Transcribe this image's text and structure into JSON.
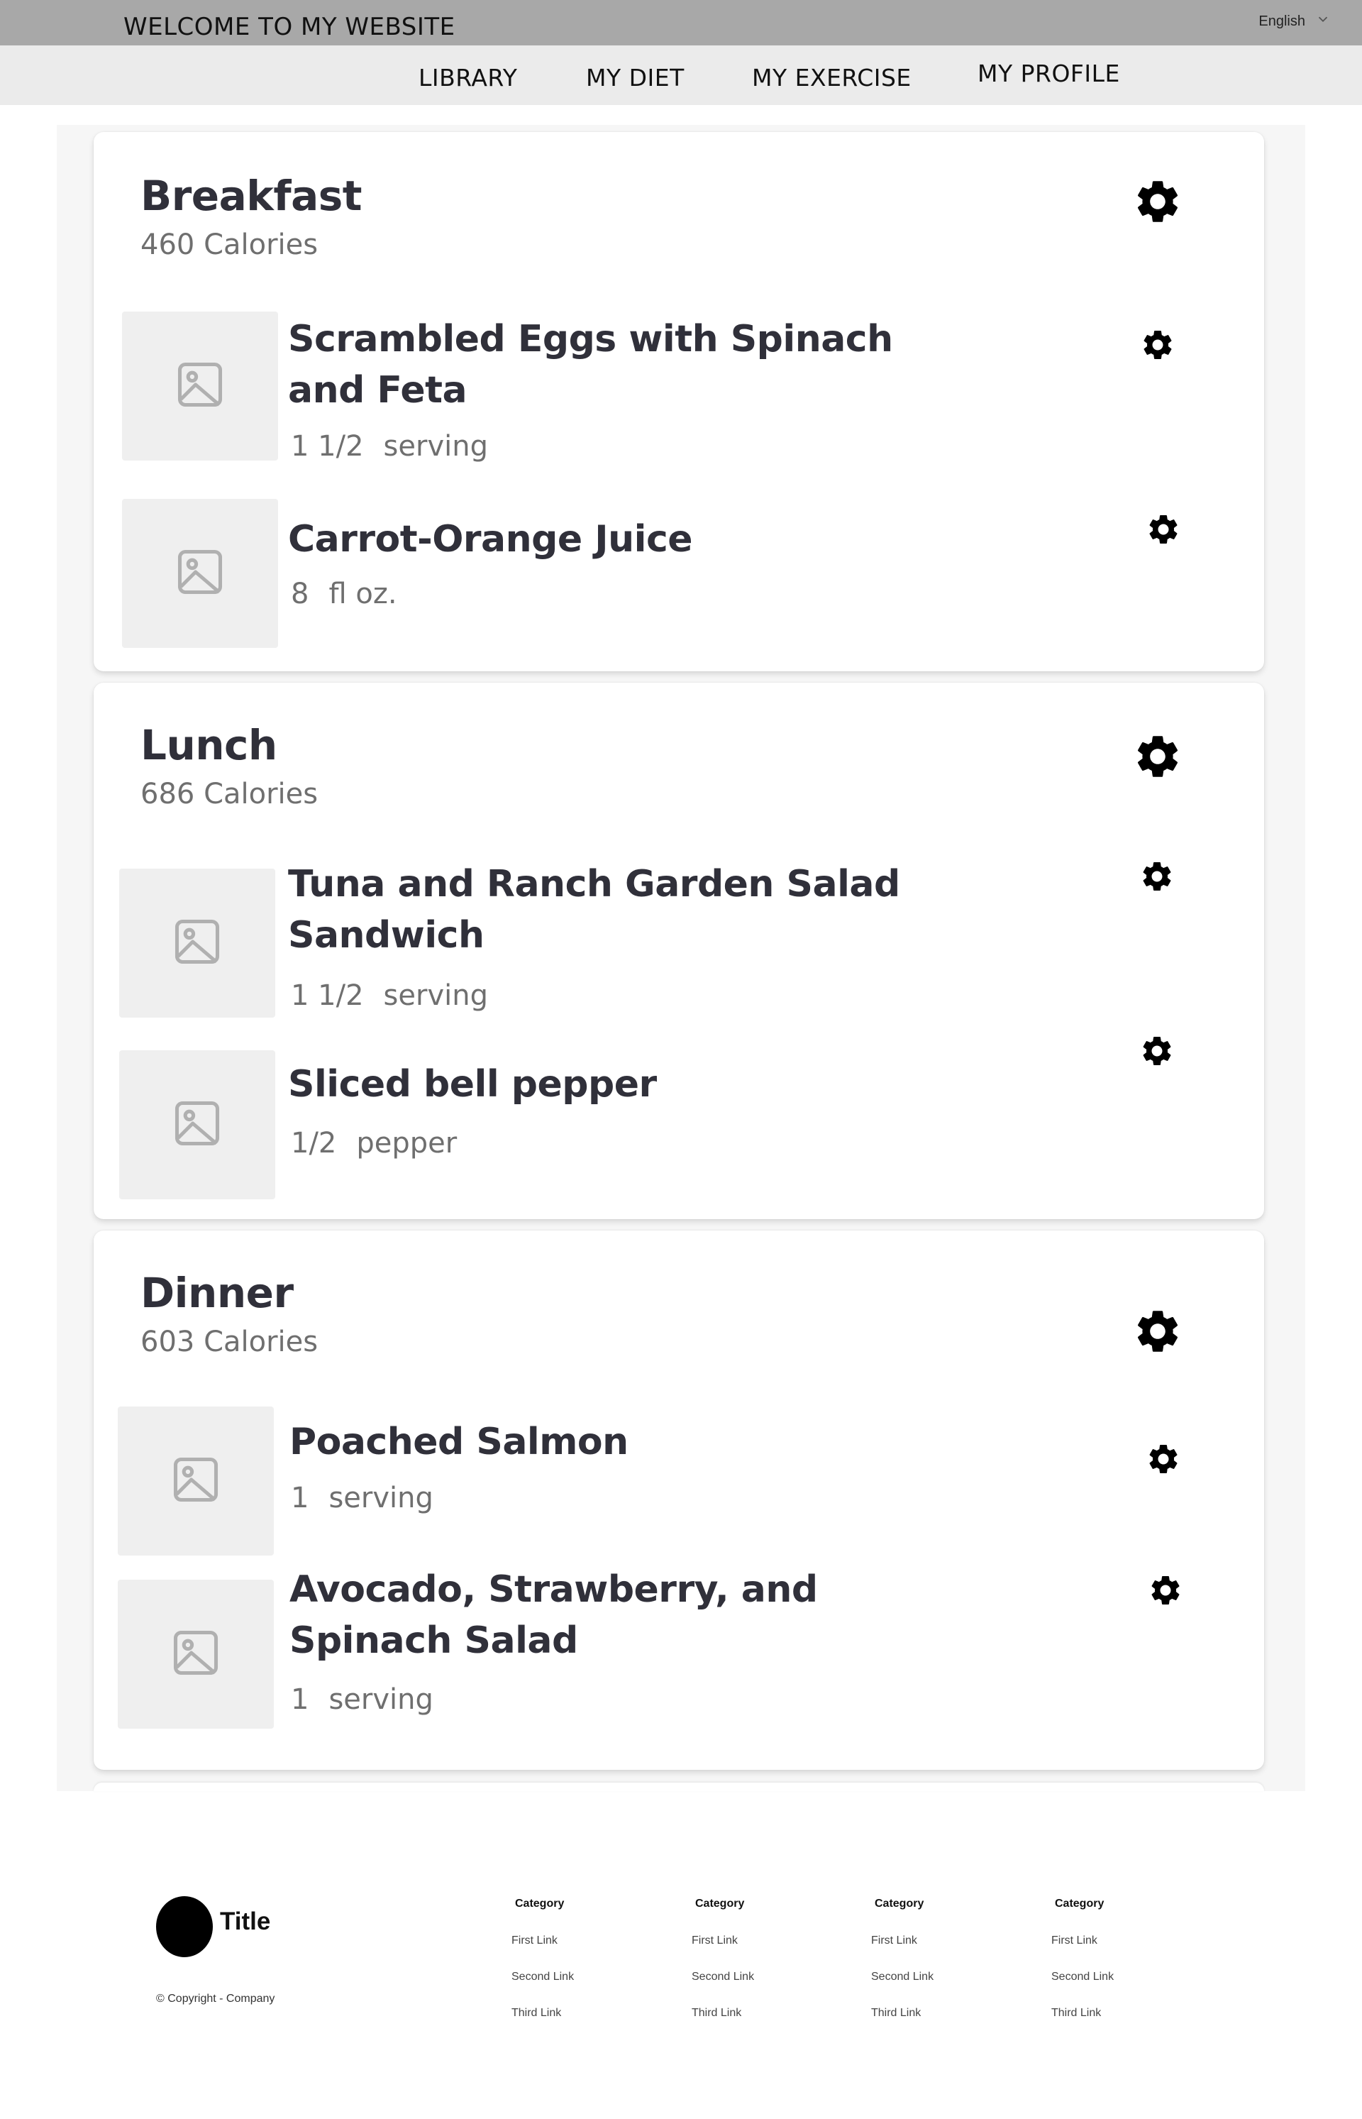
{
  "header": {
    "site_title": "WELCOME TO MY WEBSITE",
    "language": "English",
    "language_icon": "chevron-down-icon"
  },
  "nav": {
    "items": [
      "LIBRARY",
      "MY DIET",
      "MY EXERCISE",
      "MY PROFILE"
    ]
  },
  "meals": [
    {
      "name": "Breakfast",
      "calories": "460 Calories",
      "foods": [
        {
          "name": "Scrambled Eggs with Spinach and Feta",
          "amount": "1 1/2",
          "unit": "serving"
        },
        {
          "name": "Carrot-Orange Juice",
          "amount": "8",
          "unit": "fl oz."
        }
      ]
    },
    {
      "name": "Lunch",
      "calories": "686 Calories",
      "foods": [
        {
          "name": "Tuna and Ranch Garden Salad Sandwich",
          "amount": "1 1/2",
          "unit": "serving"
        },
        {
          "name": "Sliced bell pepper",
          "amount": "1/2",
          "unit": "pepper"
        }
      ]
    },
    {
      "name": "Dinner",
      "calories": "603 Calories",
      "foods": [
        {
          "name": "Poached Salmon",
          "amount": "1",
          "unit": "serving"
        },
        {
          "name": "Avocado, Strawberry, and Spinach Salad",
          "amount": "1",
          "unit": "serving"
        }
      ]
    }
  ],
  "icons": {
    "settings": "gear-icon",
    "food_image": "image-placeholder-icon"
  },
  "footer": {
    "title": "Title",
    "copyright": "© Copyright - Company",
    "columns": [
      {
        "category": "Category",
        "links": [
          "First Link",
          "Second Link",
          "Third Link"
        ]
      },
      {
        "category": "Category",
        "links": [
          "First Link",
          "Second Link",
          "Third Link"
        ]
      },
      {
        "category": "Category",
        "links": [
          "First Link",
          "Second Link",
          "Third Link"
        ]
      },
      {
        "category": "Category",
        "links": [
          "First Link",
          "Second Link",
          "Third Link"
        ]
      }
    ]
  }
}
